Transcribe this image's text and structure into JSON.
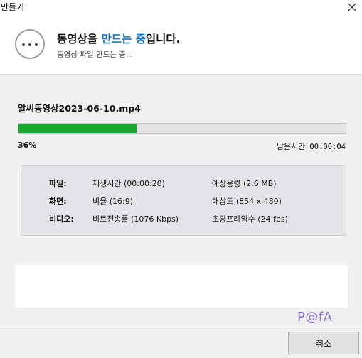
{
  "window": {
    "title": "만들기"
  },
  "header": {
    "headline_prefix": "동영상을 ",
    "headline_highlight": "만드는 중",
    "headline_suffix": "입니다.",
    "subtext": "동영상 파일 만드는 중..."
  },
  "progress": {
    "filename": "알씨동영상2023-06-10.mp4",
    "percent_label": "36%",
    "fraction": 0.36,
    "remaining_label": "남은시간",
    "remaining_value": "00:00:04"
  },
  "info": {
    "rows": [
      {
        "key": "파일:",
        "value1": "재생시간 (00:00:20)",
        "value2": "예상용량 (2.6 MB)"
      },
      {
        "key": "화면:",
        "value1": "비율 (16:9)",
        "value2": "해상도 (854 x 480)"
      },
      {
        "key": "비디오:",
        "value1": "비트전송률 (1076 Kbps)",
        "value2": "초당프레임수 (24 fps)"
      }
    ]
  },
  "watermark": "P@fA",
  "footer": {
    "cancel_label": "취소"
  },
  "colors": {
    "progress": "#19a930",
    "highlight": "#1a78c2",
    "watermark": "#8a6ad6"
  },
  "icons": {
    "close": "close-icon",
    "status": "ellipsis-icon"
  }
}
